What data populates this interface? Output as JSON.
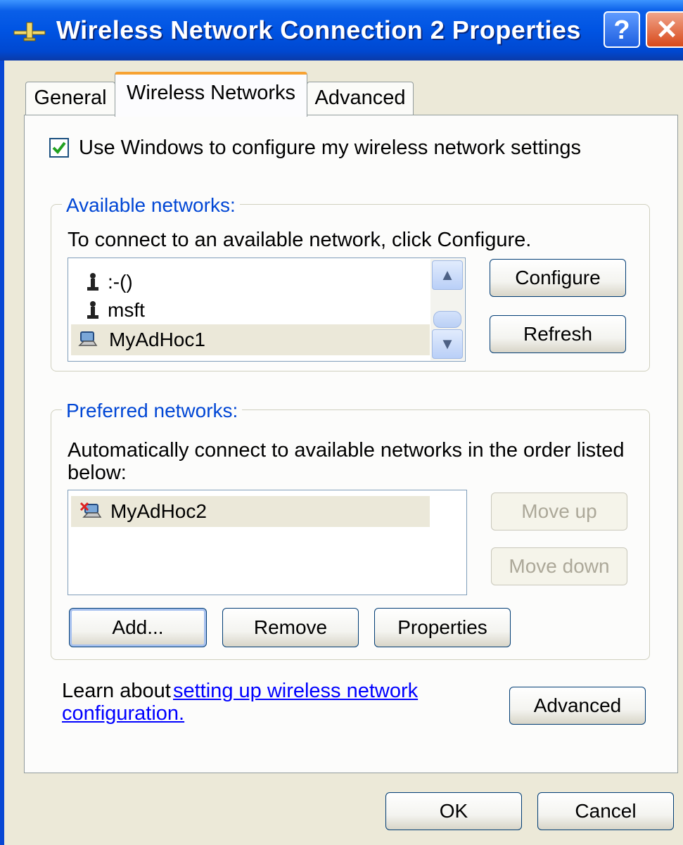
{
  "window": {
    "title": "Wireless Network Connection 2 Properties",
    "help_label": "?",
    "close_label": "✕"
  },
  "tabs": [
    "General",
    "Wireless Networks",
    "Advanced"
  ],
  "use_windows": {
    "label": "Use Windows to configure my wireless network settings",
    "checked": true
  },
  "available": {
    "legend": "Available networks:",
    "instruction": "To connect to an available network, click Configure.",
    "networks": [
      {
        "name": ":-()",
        "icon": "infrastructure-network-icon"
      },
      {
        "name": "msft",
        "icon": "infrastructure-network-icon"
      },
      {
        "name": "MyAdHoc1",
        "icon": "adhoc-network-icon",
        "selected": true
      }
    ],
    "configure_label": "Configure",
    "refresh_label": "Refresh"
  },
  "preferred": {
    "legend": "Preferred networks:",
    "instruction_line1": "Automatically connect to available networks in the order listed",
    "instruction_line2": "below:",
    "networks": [
      {
        "name": "MyAdHoc2",
        "icon": "adhoc-network-unavailable-icon",
        "selected": true
      }
    ],
    "move_up_label": "Move up",
    "move_down_label": "Move down",
    "add_label": "Add...",
    "remove_label": "Remove",
    "properties_label": "Properties"
  },
  "learn": {
    "prefix": "Learn about ",
    "link_line1": "setting up wireless network",
    "link_line2": "configuration."
  },
  "advanced_label": "Advanced",
  "ok_label": "OK",
  "cancel_label": "Cancel",
  "colors": {
    "title_bar": "#0054e3",
    "dialog_bg": "#ece9d8",
    "group_legend": "#0046d5",
    "tab_highlight": "#f7a232",
    "link": "#0000ff"
  }
}
